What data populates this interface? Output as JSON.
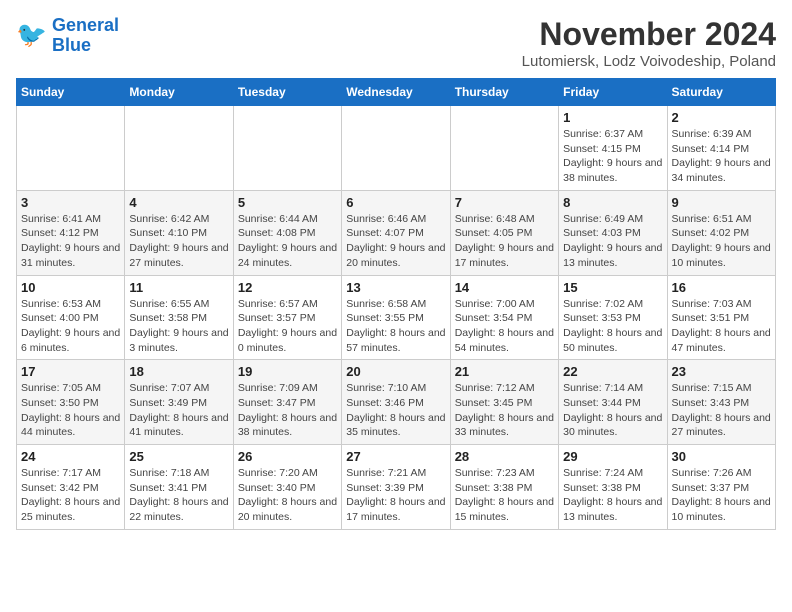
{
  "header": {
    "logo_text_general": "General",
    "logo_text_blue": "Blue",
    "month_title": "November 2024",
    "subtitle": "Lutomiersk, Lodz Voivodeship, Poland"
  },
  "weekdays": [
    "Sunday",
    "Monday",
    "Tuesday",
    "Wednesday",
    "Thursday",
    "Friday",
    "Saturday"
  ],
  "weeks": [
    [
      {
        "day": "",
        "info": ""
      },
      {
        "day": "",
        "info": ""
      },
      {
        "day": "",
        "info": ""
      },
      {
        "day": "",
        "info": ""
      },
      {
        "day": "",
        "info": ""
      },
      {
        "day": "1",
        "info": "Sunrise: 6:37 AM\nSunset: 4:15 PM\nDaylight: 9 hours and 38 minutes."
      },
      {
        "day": "2",
        "info": "Sunrise: 6:39 AM\nSunset: 4:14 PM\nDaylight: 9 hours and 34 minutes."
      }
    ],
    [
      {
        "day": "3",
        "info": "Sunrise: 6:41 AM\nSunset: 4:12 PM\nDaylight: 9 hours and 31 minutes."
      },
      {
        "day": "4",
        "info": "Sunrise: 6:42 AM\nSunset: 4:10 PM\nDaylight: 9 hours and 27 minutes."
      },
      {
        "day": "5",
        "info": "Sunrise: 6:44 AM\nSunset: 4:08 PM\nDaylight: 9 hours and 24 minutes."
      },
      {
        "day": "6",
        "info": "Sunrise: 6:46 AM\nSunset: 4:07 PM\nDaylight: 9 hours and 20 minutes."
      },
      {
        "day": "7",
        "info": "Sunrise: 6:48 AM\nSunset: 4:05 PM\nDaylight: 9 hours and 17 minutes."
      },
      {
        "day": "8",
        "info": "Sunrise: 6:49 AM\nSunset: 4:03 PM\nDaylight: 9 hours and 13 minutes."
      },
      {
        "day": "9",
        "info": "Sunrise: 6:51 AM\nSunset: 4:02 PM\nDaylight: 9 hours and 10 minutes."
      }
    ],
    [
      {
        "day": "10",
        "info": "Sunrise: 6:53 AM\nSunset: 4:00 PM\nDaylight: 9 hours and 6 minutes."
      },
      {
        "day": "11",
        "info": "Sunrise: 6:55 AM\nSunset: 3:58 PM\nDaylight: 9 hours and 3 minutes."
      },
      {
        "day": "12",
        "info": "Sunrise: 6:57 AM\nSunset: 3:57 PM\nDaylight: 9 hours and 0 minutes."
      },
      {
        "day": "13",
        "info": "Sunrise: 6:58 AM\nSunset: 3:55 PM\nDaylight: 8 hours and 57 minutes."
      },
      {
        "day": "14",
        "info": "Sunrise: 7:00 AM\nSunset: 3:54 PM\nDaylight: 8 hours and 54 minutes."
      },
      {
        "day": "15",
        "info": "Sunrise: 7:02 AM\nSunset: 3:53 PM\nDaylight: 8 hours and 50 minutes."
      },
      {
        "day": "16",
        "info": "Sunrise: 7:03 AM\nSunset: 3:51 PM\nDaylight: 8 hours and 47 minutes."
      }
    ],
    [
      {
        "day": "17",
        "info": "Sunrise: 7:05 AM\nSunset: 3:50 PM\nDaylight: 8 hours and 44 minutes."
      },
      {
        "day": "18",
        "info": "Sunrise: 7:07 AM\nSunset: 3:49 PM\nDaylight: 8 hours and 41 minutes."
      },
      {
        "day": "19",
        "info": "Sunrise: 7:09 AM\nSunset: 3:47 PM\nDaylight: 8 hours and 38 minutes."
      },
      {
        "day": "20",
        "info": "Sunrise: 7:10 AM\nSunset: 3:46 PM\nDaylight: 8 hours and 35 minutes."
      },
      {
        "day": "21",
        "info": "Sunrise: 7:12 AM\nSunset: 3:45 PM\nDaylight: 8 hours and 33 minutes."
      },
      {
        "day": "22",
        "info": "Sunrise: 7:14 AM\nSunset: 3:44 PM\nDaylight: 8 hours and 30 minutes."
      },
      {
        "day": "23",
        "info": "Sunrise: 7:15 AM\nSunset: 3:43 PM\nDaylight: 8 hours and 27 minutes."
      }
    ],
    [
      {
        "day": "24",
        "info": "Sunrise: 7:17 AM\nSunset: 3:42 PM\nDaylight: 8 hours and 25 minutes."
      },
      {
        "day": "25",
        "info": "Sunrise: 7:18 AM\nSunset: 3:41 PM\nDaylight: 8 hours and 22 minutes."
      },
      {
        "day": "26",
        "info": "Sunrise: 7:20 AM\nSunset: 3:40 PM\nDaylight: 8 hours and 20 minutes."
      },
      {
        "day": "27",
        "info": "Sunrise: 7:21 AM\nSunset: 3:39 PM\nDaylight: 8 hours and 17 minutes."
      },
      {
        "day": "28",
        "info": "Sunrise: 7:23 AM\nSunset: 3:38 PM\nDaylight: 8 hours and 15 minutes."
      },
      {
        "day": "29",
        "info": "Sunrise: 7:24 AM\nSunset: 3:38 PM\nDaylight: 8 hours and 13 minutes."
      },
      {
        "day": "30",
        "info": "Sunrise: 7:26 AM\nSunset: 3:37 PM\nDaylight: 8 hours and 10 minutes."
      }
    ]
  ]
}
